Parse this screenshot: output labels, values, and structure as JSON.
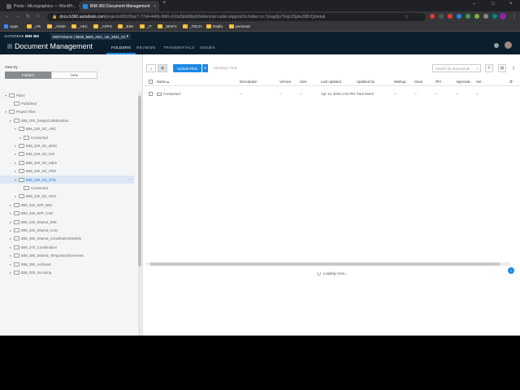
{
  "browser": {
    "tabs": [
      {
        "title": "Posts ‹ Micrographics — WordPr...",
        "active": false
      },
      {
        "title": "BIM 360 Document Management",
        "active": true
      }
    ],
    "new_tab": "+",
    "window_controls": [
      "–",
      "□",
      "×"
    ],
    "url_host": "docs.b360.autodesk.com",
    "url_path": "/projects/68109ac7-77d4-446b-9fd0-c61b2bbb98a5/folders/urn:adsk.wipprod:fs.folder:co.7znapQoTEqL6SjAs298VQ/detail",
    "bookmarks": [
      "Apps",
      "_AR",
      "_ADSK",
      "_AEC",
      "_APPS",
      "_BIM",
      "_IT",
      "_MGFX",
      "_TECH",
      "Radio",
      "personal"
    ]
  },
  "app": {
    "brand": "AUTODESK",
    "product": "BIM 360",
    "project": "MGFXStorm",
    "project_name": "NEW_BEN_AEC_UK_2021_01",
    "module_title": "Document Management",
    "nav_tabs": [
      {
        "label": "FOLDERS",
        "active": true
      },
      {
        "label": "REVIEWS",
        "active": false
      },
      {
        "label": "TRANSMITTALS",
        "active": false
      },
      {
        "label": "ISSUES",
        "active": false
      }
    ]
  },
  "left_panel": {
    "view_by": "View by",
    "toggle": {
      "folders": "Folders",
      "sets": "Sets"
    },
    "tree": [
      {
        "label": "Plans",
        "depth": 0,
        "caret": "▾"
      },
      {
        "label": "Published",
        "depth": 1,
        "caret": ""
      },
      {
        "label": "Project Files",
        "depth": 0,
        "caret": "▾"
      },
      {
        "label": "BIM_000_DesignCollaboration",
        "depth": 1,
        "caret": "▸"
      },
      {
        "label": "BIM_320_DC_ARC",
        "depth": 2,
        "caret": "▾"
      },
      {
        "label": "Consumed",
        "depth": 3,
        "caret": "▸"
      },
      {
        "label": "BIM_320_DC_BDM",
        "depth": 2,
        "caret": "▸"
      },
      {
        "label": "BIM_320_DC_EXI",
        "depth": 2,
        "caret": "▸"
      },
      {
        "label": "BIM_320_DC_MEG",
        "depth": 2,
        "caret": "▸"
      },
      {
        "label": "BIM_320_DC_PDD",
        "depth": 2,
        "caret": "▸"
      },
      {
        "label": "BIM_320_DC_STG",
        "depth": 2,
        "caret": "▾",
        "selected": true
      },
      {
        "label": "Consumed",
        "depth": 3,
        "caret": ""
      },
      {
        "label": "BIM_320_DC_KEG",
        "depth": 2,
        "caret": "▸"
      },
      {
        "label": "BIM_320_WIP_BIM",
        "depth": 1,
        "caret": "▸"
      },
      {
        "label": "BIM_330_WIP_CAD",
        "depth": 1,
        "caret": "▸"
      },
      {
        "label": "BIM_340_Shared_BIM",
        "depth": 1,
        "caret": "▸"
      },
      {
        "label": "BIM_340_Shared_CAD",
        "depth": 1,
        "caret": "▸"
      },
      {
        "label": "BIM_350_Shared_CoordinationModels",
        "depth": 1,
        "caret": "▸"
      },
      {
        "label": "BIM_370_Coordination",
        "depth": 1,
        "caret": "▸"
      },
      {
        "label": "BIM_380_Shared_TemporaryShareArea",
        "depth": 1,
        "caret": "▸"
      },
      {
        "label": "BIM_390_Archived",
        "depth": 1,
        "caret": "▸"
      },
      {
        "label": "BIM_300_Incoming",
        "depth": 1,
        "caret": "▸"
      }
    ]
  },
  "toolbar": {
    "upload": "Upload Files",
    "upload_caret": "▾",
    "showing": "Showing 1 item",
    "search_placeholder": "Search for documents"
  },
  "table": {
    "columns": [
      "Name",
      "Description",
      "Version",
      "Size",
      "Last updated",
      "Updated by",
      "Markup",
      "Issue",
      "RFI",
      "Approval...",
      "Set"
    ],
    "rows": [
      {
        "name": "Consumed",
        "description": "--",
        "version": "--",
        "size": "--",
        "last_updated": "Apr 13, 2020 1:52 PM",
        "updated_by": "Paul Storm",
        "markup": "--",
        "issue": "--",
        "rfi": "--",
        "approval": "--",
        "set": "--"
      }
    ]
  },
  "status": {
    "loading": "Loading more..."
  },
  "colors": {
    "accent": "#1e88e5",
    "header_bg": "#0b1e2d",
    "chrome_bg": "#35363a"
  }
}
